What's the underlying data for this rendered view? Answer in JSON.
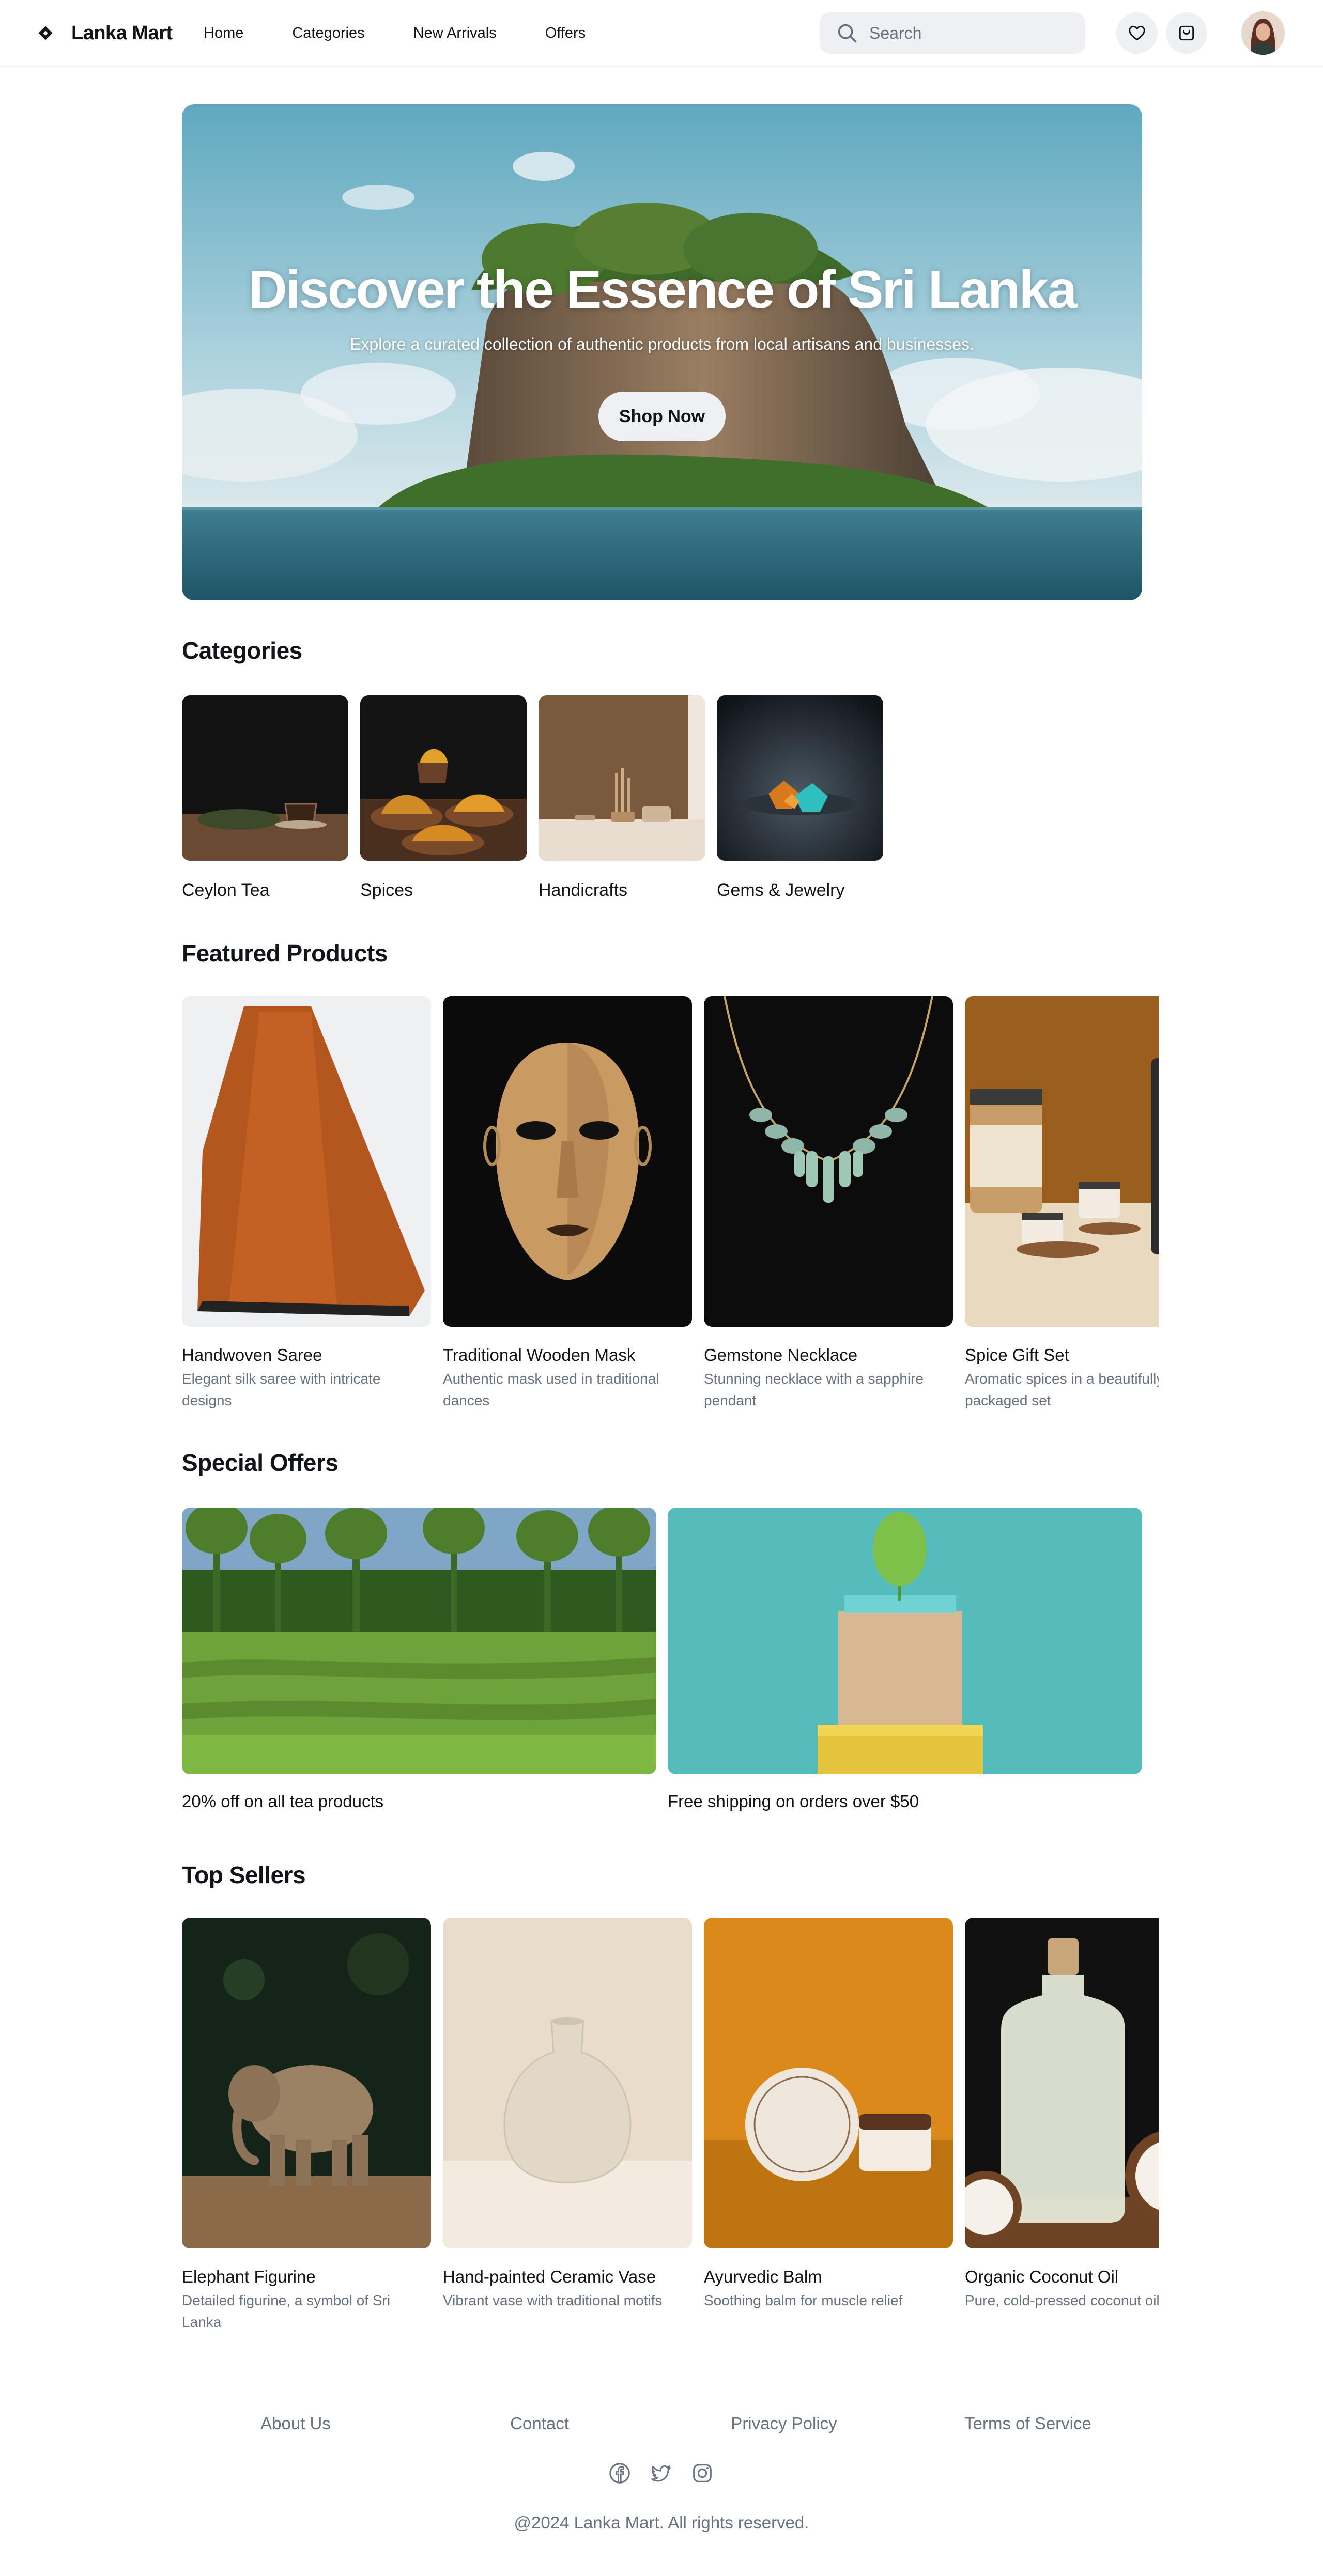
{
  "header": {
    "brand": "Lanka Mart",
    "nav": [
      "Home",
      "Categories",
      "New Arrivals",
      "Offers"
    ],
    "search_placeholder": "Search",
    "icons": [
      "heart-icon",
      "cart-icon"
    ]
  },
  "hero": {
    "title": "Discover the Essence of Sri Lanka",
    "subtitle": "Explore a curated collection of authentic products from local artisans and businesses.",
    "cta": "Shop Now"
  },
  "categories": {
    "title": "Categories",
    "items": [
      "Ceylon Tea",
      "Spices",
      "Handicrafts",
      "Gems & Jewelry"
    ]
  },
  "featured": {
    "title": "Featured Products",
    "items": [
      {
        "name": "Handwoven Saree",
        "desc": "Elegant silk saree with intricate designs"
      },
      {
        "name": "Traditional Wooden Mask",
        "desc": "Authentic mask used in traditional dances"
      },
      {
        "name": "Gemstone Necklace",
        "desc": "Stunning necklace with a sapphire pendant"
      },
      {
        "name": "Spice Gift Set",
        "desc": "Aromatic spices in a beautifully packaged set"
      }
    ]
  },
  "offers": {
    "title": "Special Offers",
    "items": [
      "20% off on all tea products",
      "Free shipping on orders over $50"
    ]
  },
  "top_sellers": {
    "title": "Top Sellers",
    "items": [
      {
        "name": "Elephant Figurine",
        "desc": "Detailed figurine, a symbol of Sri Lanka"
      },
      {
        "name": "Hand-painted Ceramic Vase",
        "desc": "Vibrant vase with traditional motifs"
      },
      {
        "name": "Ayurvedic Balm",
        "desc": "Soothing balm for muscle relief"
      },
      {
        "name": "Organic Coconut Oil",
        "desc": "Pure, cold-pressed coconut oil"
      }
    ]
  },
  "footer": {
    "links": [
      "About Us",
      "Contact",
      "Privacy Policy",
      "Terms of Service"
    ],
    "socials": [
      "facebook-icon",
      "twitter-icon",
      "instagram-icon"
    ],
    "copyright": "@2024 Lanka Mart. All rights reserved."
  },
  "colors": {
    "text": "#111418",
    "muted": "#687280",
    "surface": "#eef0f3",
    "background": "#ffffff"
  }
}
